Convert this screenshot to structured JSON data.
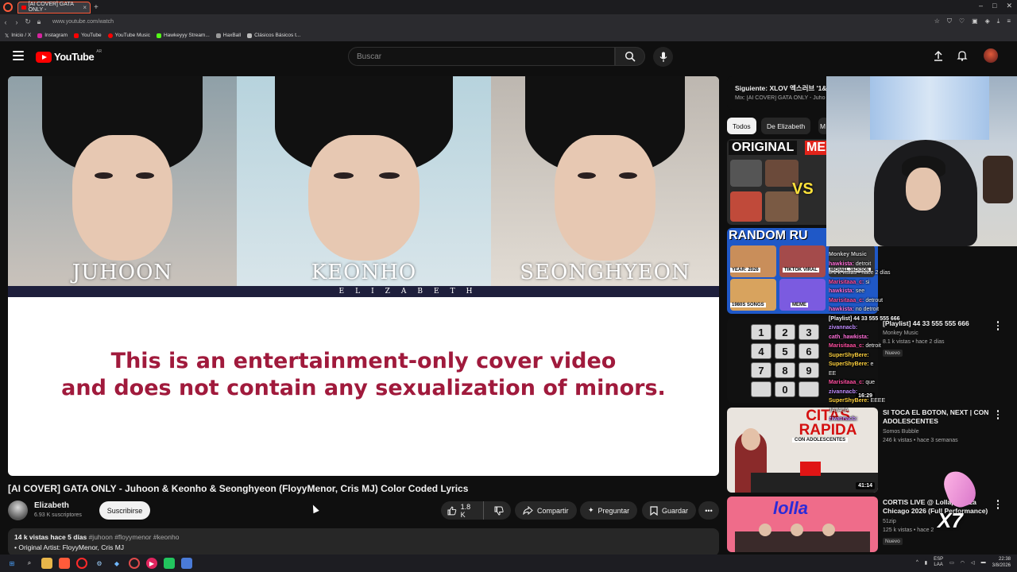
{
  "browser": {
    "tab_title": "[AI COVER] GATA ONLY -",
    "tab_close": "×",
    "new_tab": "+",
    "url": "www.youtube.com/watch",
    "bookmarks": [
      "Inicio / X",
      "Instagram",
      "YouTube",
      "YouTube Music",
      "Hawkeyyy Stream...",
      "HaxBall",
      "Clásicos Básicos t..."
    ]
  },
  "header": {
    "logo_text": "YouTube",
    "region": "AR",
    "search_placeholder": "Buscar"
  },
  "player": {
    "names": [
      "JUHOON",
      "KEONHO",
      "SEONGHYEON"
    ],
    "band_text": "ELIZABETH",
    "disclaimer_line1": "This is an entertainment-only cover video",
    "disclaimer_line2": "and does not contain any sexualization of minors."
  },
  "video": {
    "title": "[AI COVER] GATA ONLY - Juhoon & Keonho & Seonghyeon (FloyyMenor, Cris MJ) Color Coded Lyrics",
    "channel": "Elizabeth",
    "subscribers": "6.93 K suscriptores",
    "subscribe_label": "Suscribirse",
    "likes": "1.8 K",
    "share_label": "Compartir",
    "ask_label": "Preguntar",
    "save_label": "Guardar",
    "views_time": "14 k vistas  hace 5 días",
    "tags": "#juhoon #floyymenor #keonho",
    "desc_line2": "• Original Artist: FloyyMenor, Cris MJ"
  },
  "sidebar": {
    "next_title": "Siguiente: XLOV 엑스러브 '1&",
    "next_sub": "Mix: [AI COVER] GATA ONLY - Juho",
    "chips": [
      "Todos",
      "De Elizabeth",
      "M"
    ],
    "thumb1_top": "ORIGINAL",
    "thumb1_me": "ME",
    "thumb1_vs": "VS",
    "thumb2_top": "RANDOM RU",
    "thumb2_labels": [
      "YEAR: 2026",
      "TIKTOK VIRAL",
      "MICHAEL JACKSON",
      "1980S SONGS",
      "MEME"
    ],
    "keypad": [
      "1",
      "2",
      "3",
      "4",
      "5",
      "6",
      "7",
      "8",
      "9",
      "",
      "0",
      ""
    ],
    "videos": [
      {
        "title": "[Playlist] 44 33 555 555 666",
        "meta": "Monkey Music",
        "meta2": "8.1 k vistas • hace 2 días",
        "duration": "16:29",
        "badge": "Nuevo"
      },
      {
        "title": "SI TOCA EL BOTON, NEXT | CON ADOLESCENTES",
        "meta": "Somos Bubble",
        "meta2": "246 k vistas • hace 3 semanas",
        "duration": "41:14",
        "thumb_text": "CITAS RAPIDA",
        "thumb_sub": "CON ADOLESCENTES"
      },
      {
        "title": "CORTIS LIVE @ Lollapalooza Chicago 2026 (Full Performance)",
        "meta": "51zip",
        "meta2": "125 k vistas • hace 2",
        "badge": "Nuevo",
        "thumb_text": "lolla"
      }
    ]
  },
  "chat": [
    {
      "user": "Monkey Music",
      "text": "",
      "color": "#cfcfcf"
    },
    {
      "user": "hawkista:",
      "text": "detroit",
      "color": "#ff6fd8"
    },
    {
      "user": "",
      "text": "8.1 k vistas • hace 2 días",
      "color": "#bbbbbb"
    },
    {
      "user": "Marisitaaa_c:",
      "text": "si",
      "color": "#ff4fa0"
    },
    {
      "user": "hawkista:",
      "text": "see",
      "color": "#ff6fd8"
    },
    {
      "user": "Marisitaaa_c:",
      "text": "detrout",
      "color": "#ff4fa0"
    },
    {
      "user": "hawkista:",
      "text": "no detroit",
      "color": "#ff6fd8"
    },
    {
      "user": "[Playlist] 44 33 555 555 666",
      "text": "",
      "color": "#ffffff"
    },
    {
      "user": "zivannacb:",
      "text": "",
      "color": "#c08cff"
    },
    {
      "user": "cath_hawkista:",
      "text": "",
      "color": "#ff6fd8"
    },
    {
      "user": "Marisitaaa_c:",
      "text": "detroit",
      "color": "#ff4fa0"
    },
    {
      "user": "SuperShyBere:",
      "text": "",
      "color": "#ffd23f"
    },
    {
      "user": "SuperShyBere:",
      "text": "e",
      "color": "#ffd23f"
    },
    {
      "user": "",
      "text": "EE",
      "color": "#ff4fa0"
    },
    {
      "user": "Marisitaaa_c:",
      "text": "que",
      "color": "#ff4fa0"
    },
    {
      "user": "zivannacb:",
      "text": "",
      "color": "#c08cff"
    },
    {
      "user": "SuperShyBere:",
      "text": "EEEE",
      "color": "#ffd23f"
    },
    {
      "user": "",
      "text": "JAJAJA",
      "color": "#ff4fa0"
    },
    {
      "user": "zivannacb:",
      "text": "",
      "color": "#c08cff"
    }
  ],
  "overlay": {
    "badge_text": "X7"
  },
  "taskbar": {
    "lang_line1": "ESP",
    "lang_line2": "LAA",
    "time": "22:38",
    "date": "3/8/2026"
  },
  "colors": {
    "youtube_red": "#ff0000",
    "disclaimer": "#a01a3c",
    "accent_tab": "#ff5b3a"
  }
}
